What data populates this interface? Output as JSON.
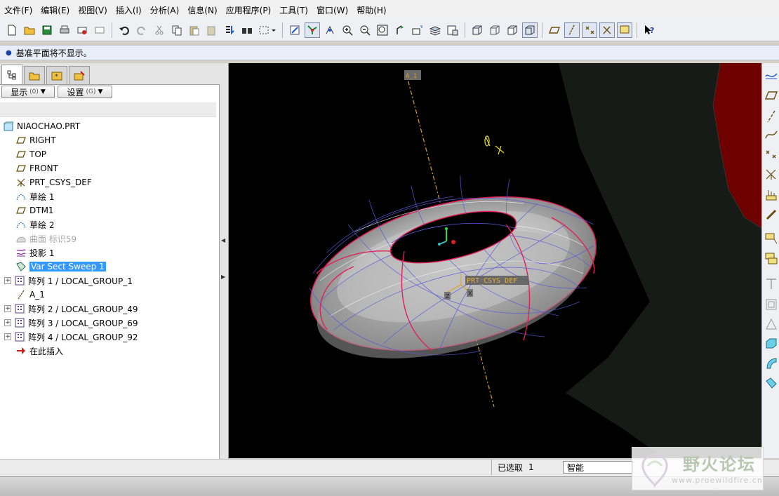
{
  "menubar": {
    "items": [
      "文件(F)",
      "编辑(E)",
      "视图(V)",
      "插入(I)",
      "分析(A)",
      "信息(N)",
      "应用程序(P)",
      "工具(T)",
      "窗口(W)",
      "帮助(H)"
    ]
  },
  "toolbar": {
    "icons": [
      "new-icon",
      "open-icon",
      "save-icon",
      "print-icon",
      "email-icon",
      "email-link-icon",
      "undo-icon",
      "redo-icon",
      "cut-icon",
      "copy-icon",
      "paste-icon",
      "paste-special-icon",
      "regenerate-icon",
      "find-icon",
      "select-box-icon",
      "repaint-icon",
      "spin-center-icon",
      "orient-icon",
      "zoom-in-icon",
      "zoom-out-icon",
      "refit-icon",
      "reorient-icon",
      "named-views-icon",
      "layers-icon",
      "view-manager-icon",
      "wireframe-icon",
      "hidden-line-icon",
      "no-hidden-icon",
      "shading-icon",
      "datum-planes-icon",
      "datum-axes-icon",
      "datum-points-icon",
      "csys-icon",
      "whats-this-icon"
    ]
  },
  "message": {
    "text": "基准平面将不显示。"
  },
  "panel": {
    "show_label": "显示",
    "show_key": "(0)",
    "settings_label": "设置",
    "settings_key": "(G)"
  },
  "tree": {
    "root": "NIAOCHAO.PRT",
    "items": [
      {
        "label": "RIGHT",
        "icon": "datum-plane-icon"
      },
      {
        "label": "TOP",
        "icon": "datum-plane-icon"
      },
      {
        "label": "FRONT",
        "icon": "datum-plane-icon"
      },
      {
        "label": "PRT_CSYS_DEF",
        "icon": "csys-icon"
      },
      {
        "label": "草绘 1",
        "icon": "sketch-icon"
      },
      {
        "label": "DTM1",
        "icon": "datum-plane-icon"
      },
      {
        "label": "草绘 2",
        "icon": "sketch-icon"
      },
      {
        "label": "曲面 标识59",
        "icon": "surface-icon",
        "dim": true
      },
      {
        "label": "投影 1",
        "icon": "projection-icon"
      },
      {
        "label": "Var Sect Sweep 1",
        "icon": "sweep-icon",
        "selected": true
      },
      {
        "label": "阵列 1 / LOCAL_GROUP_1",
        "icon": "pattern-icon",
        "expandable": true
      },
      {
        "label": "A_1",
        "icon": "axis-icon"
      },
      {
        "label": "阵列 2 / LOCAL_GROUP_49",
        "icon": "pattern-icon",
        "expandable": true
      },
      {
        "label": "阵列 3 / LOCAL_GROUP_69",
        "icon": "pattern-icon",
        "expandable": true
      },
      {
        "label": "阵列 4 / LOCAL_GROUP_92",
        "icon": "pattern-icon",
        "expandable": true
      },
      {
        "label": "在此插入",
        "icon": "insert-here-icon"
      }
    ]
  },
  "viewport": {
    "axis_label": "A_1",
    "csys_label": "PRT_CSYS_DEF",
    "csys_z": "Z",
    "csys_x": "X",
    "colors": {
      "background": "#000000",
      "torus": "#b8b8b8",
      "edges": "#e0205a",
      "curves": "#5a5ad8",
      "axis": "#d8a020",
      "datum_side": "#1a1f1a",
      "red_region": "#7a0000"
    }
  },
  "status": {
    "selected_label": "已选取",
    "selected_count": "1",
    "filter": "智能"
  },
  "watermark": {
    "text": "野火论坛",
    "url": "www.proewildfire.cn"
  }
}
